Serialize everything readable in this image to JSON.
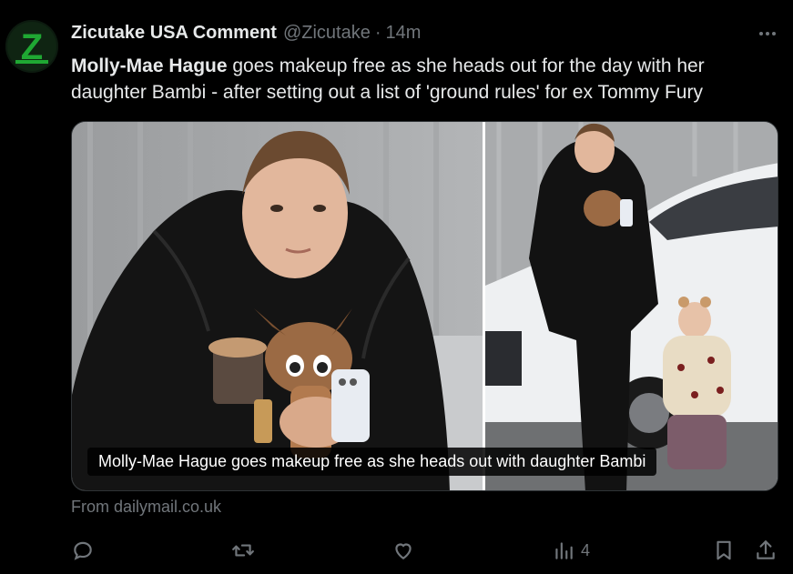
{
  "tweet": {
    "author_name": "Zicutake USA Comment",
    "handle": "@Zicutake",
    "separator": "·",
    "time": "14m",
    "avatar_letter": "Z",
    "text_bold": "Molly-Mae Hague",
    "text_rest": " goes makeup free as she heads out for the day with her daughter Bambi - after setting out a list of 'ground rules' for ex Tommy Fury",
    "media_caption": "Molly-Mae Hague goes makeup free as she heads out with daughter Bambi",
    "source": "From dailymail.co.uk"
  },
  "actions": {
    "views_count": "4"
  },
  "icons": {
    "more": "more-horizontal-icon",
    "reply": "reply-icon",
    "retweet": "retweet-icon",
    "like": "like-icon",
    "views": "views-icon",
    "bookmark": "bookmark-icon",
    "share": "share-icon"
  },
  "colors": {
    "background": "#000000",
    "text": "#e7e9ea",
    "muted": "#71767b",
    "avatar_green": "#1fa833"
  }
}
